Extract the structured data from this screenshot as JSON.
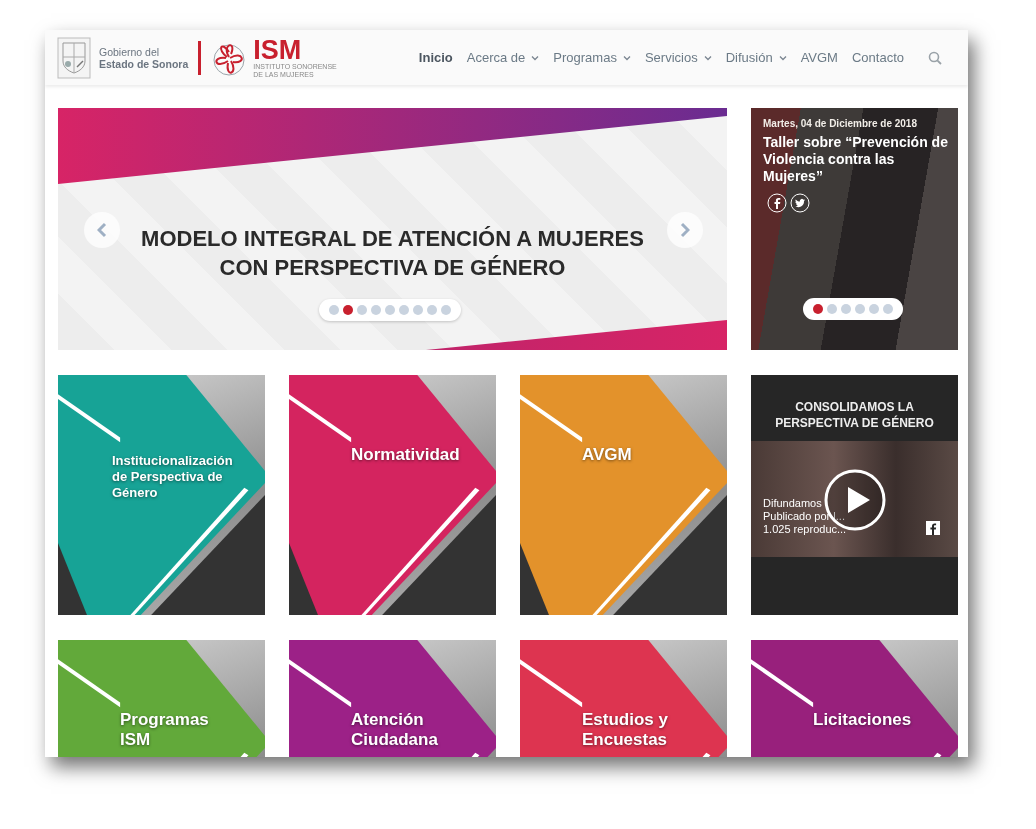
{
  "header": {
    "government": [
      "Gobierno del",
      "Estado de Sonora"
    ],
    "brand": "ISM",
    "brand_subtitle": "INSTITUTO SONORENSE DE LAS MUJERES"
  },
  "nav": [
    {
      "label": "Inicio",
      "selected": true,
      "has_menu": false
    },
    {
      "label": "Acerca de",
      "selected": false,
      "has_menu": true
    },
    {
      "label": "Programas",
      "selected": false,
      "has_menu": true
    },
    {
      "label": "Servicios",
      "selected": false,
      "has_menu": true
    },
    {
      "label": "Difusión",
      "selected": false,
      "has_menu": true
    },
    {
      "label": "AVGM",
      "selected": false,
      "has_menu": false
    },
    {
      "label": "Contacto",
      "selected": false,
      "has_menu": false
    }
  ],
  "hero": {
    "title": "MODELO INTEGRAL DE ATENCIÓN A MUJERES CON PERSPECTIVA DE GÉNERO",
    "dots": [
      {
        "selected": false
      },
      {
        "selected": true
      },
      {
        "selected": false
      },
      {
        "selected": false
      },
      {
        "selected": false
      },
      {
        "selected": false
      },
      {
        "selected": false
      },
      {
        "selected": false
      },
      {
        "selected": false
      }
    ]
  },
  "news": {
    "date": "Martes, 04 de Diciembre de 2018",
    "title": "Taller sobre “Prevención de Violencia contra las Mujeres”",
    "dots": [
      {
        "selected": true
      },
      {
        "selected": false
      },
      {
        "selected": false
      },
      {
        "selected": false
      },
      {
        "selected": false
      },
      {
        "selected": false
      }
    ]
  },
  "tiles": [
    {
      "kind": "tile",
      "title": "Institucionalización de Perspectiva de Género",
      "color": "#17a396"
    },
    {
      "kind": "tile",
      "title": "Normatividad",
      "color": "#d4245f"
    },
    {
      "kind": "tile",
      "title": "AVGM",
      "color": "#e3922b"
    },
    {
      "kind": "video",
      "heading": "CONSOLIDAMOS LA PERSPECTIVA DE GÉNERO",
      "lines": [
        "Difundamos",
        "Publicado por l...",
        "1.025 reproduc..."
      ]
    },
    {
      "kind": "tile",
      "title": "Programas ISM",
      "color": "#62a93a"
    },
    {
      "kind": "tile",
      "title": "Atención Ciudadana",
      "color": "#9c2187"
    },
    {
      "kind": "tile",
      "title": "Estudios y Encuestas",
      "color": "#dd3450"
    },
    {
      "kind": "tile",
      "title": "Licitaciones",
      "color": "#98207c"
    }
  ]
}
